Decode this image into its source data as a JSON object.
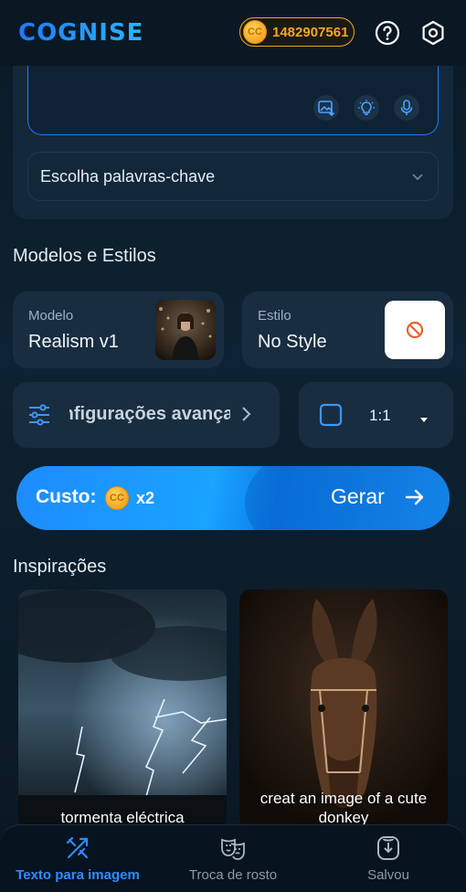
{
  "header": {
    "logo": "COGNISE",
    "coin_badge": "CC",
    "credits": "1482907561",
    "help_icon": "help-circle-icon",
    "settings_icon": "settings-icon"
  },
  "prompt": {
    "image_icon": "image-upload-icon",
    "idea_icon": "lightbulb-icon",
    "mic_icon": "microphone-icon",
    "keywords_placeholder": "Escolha palavras-chave"
  },
  "models_section": {
    "title": "Modelos e Estilos",
    "model_label": "Modelo",
    "model_value": "Realism v1",
    "style_label": "Estilo",
    "style_value": "No Style"
  },
  "settings": {
    "advanced_label": "Configurações avançadas",
    "aspect_ratio": "1:1"
  },
  "generate": {
    "cost_label": "Custo:",
    "coin_badge": "CC",
    "multiplier": "x2",
    "button_label": "Gerar"
  },
  "inspirations": {
    "title": "Inspirações",
    "items": [
      {
        "caption": "tormenta eléctrica"
      },
      {
        "caption": "creat an image of a cute donkey"
      }
    ]
  },
  "bottom_nav": {
    "items": [
      {
        "label": "Texto para imagem",
        "icon": "text-to-image-icon",
        "active": true
      },
      {
        "label": "Troca de rosto",
        "icon": "face-swap-masks-icon",
        "active": false
      },
      {
        "label": "Salvou",
        "icon": "saved-download-icon",
        "active": false
      }
    ]
  },
  "colors": {
    "accent": "#1e7bff",
    "coin": "#f5a623",
    "background": "#0d2232",
    "card": "#182d40"
  }
}
